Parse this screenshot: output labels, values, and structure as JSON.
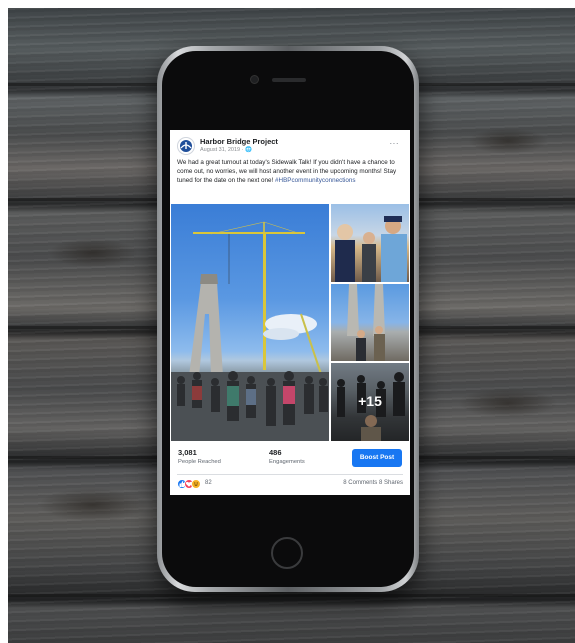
{
  "post": {
    "page_name": "Harbor Bridge Project",
    "date": "August 31, 2019 · 🌐",
    "more_label": "···",
    "text_main": "We had a great turnout at today's Sidewalk Talk! If you didn't have a chance to come out, no worries, we will host another event in the upcoming months! Stay tuned for the date on the next one! ",
    "hashtag": "#HBPcommunityconnections",
    "photos_more": "+15"
  },
  "stats": {
    "people_reached": "3,081",
    "people_reached_label": "People Reached",
    "engagements": "486",
    "engagements_label": "Engagements",
    "boost_label": "Boost Post"
  },
  "reactions": {
    "count": "82",
    "comments_shares": "8 Comments  8 Shares"
  },
  "colors": {
    "accent": "#1877f2",
    "link": "#385898"
  }
}
